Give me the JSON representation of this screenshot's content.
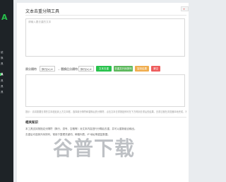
{
  "sidebar": {
    "logo": "A",
    "items": [
      "统",
      "换",
      "具",
      "具",
      "具",
      "具",
      "具"
    ]
  },
  "main": {
    "title": "文本去重分隔工具",
    "input_placeholder": "请输入要去重的文本",
    "controls": {
      "sep_label": "原分隔符",
      "sep_value": "换行(\\n) ▾",
      "target_label": "→ 替换后分隔符",
      "target_value": "换行(\\n) ▾",
      "btn_dedupe": "文本去重",
      "btn_dedupe_sort": "去重并升序排列",
      "btn_copy": "复制结果",
      "btn_clear": "清空"
    },
    "hint": "提示：请将需要去重的文本粘贴到上方文本框，选择原分隔符和替换后的分隔符，点击文本去重按钮即可在下方得到去重后的结果，去重过程在浏览器本地完成，不会上传到服务器。",
    "section_title": "相关知识",
    "desc_lines": [
      "本工具支持按指定分隔符（换行、逗号、空格等）对文本内容进行分隔后去重，并可以重新组合输出。",
      "去重后可选择升序排列，常用于整理关键词、邮箱列表、IP 地址等重复数据。"
    ]
  },
  "watermark": "谷普下载",
  "colors": {
    "primary": "#27c24c",
    "warning": "#f0ad4e",
    "danger": "#ee5d5d",
    "sidebar": "#1e2327"
  }
}
